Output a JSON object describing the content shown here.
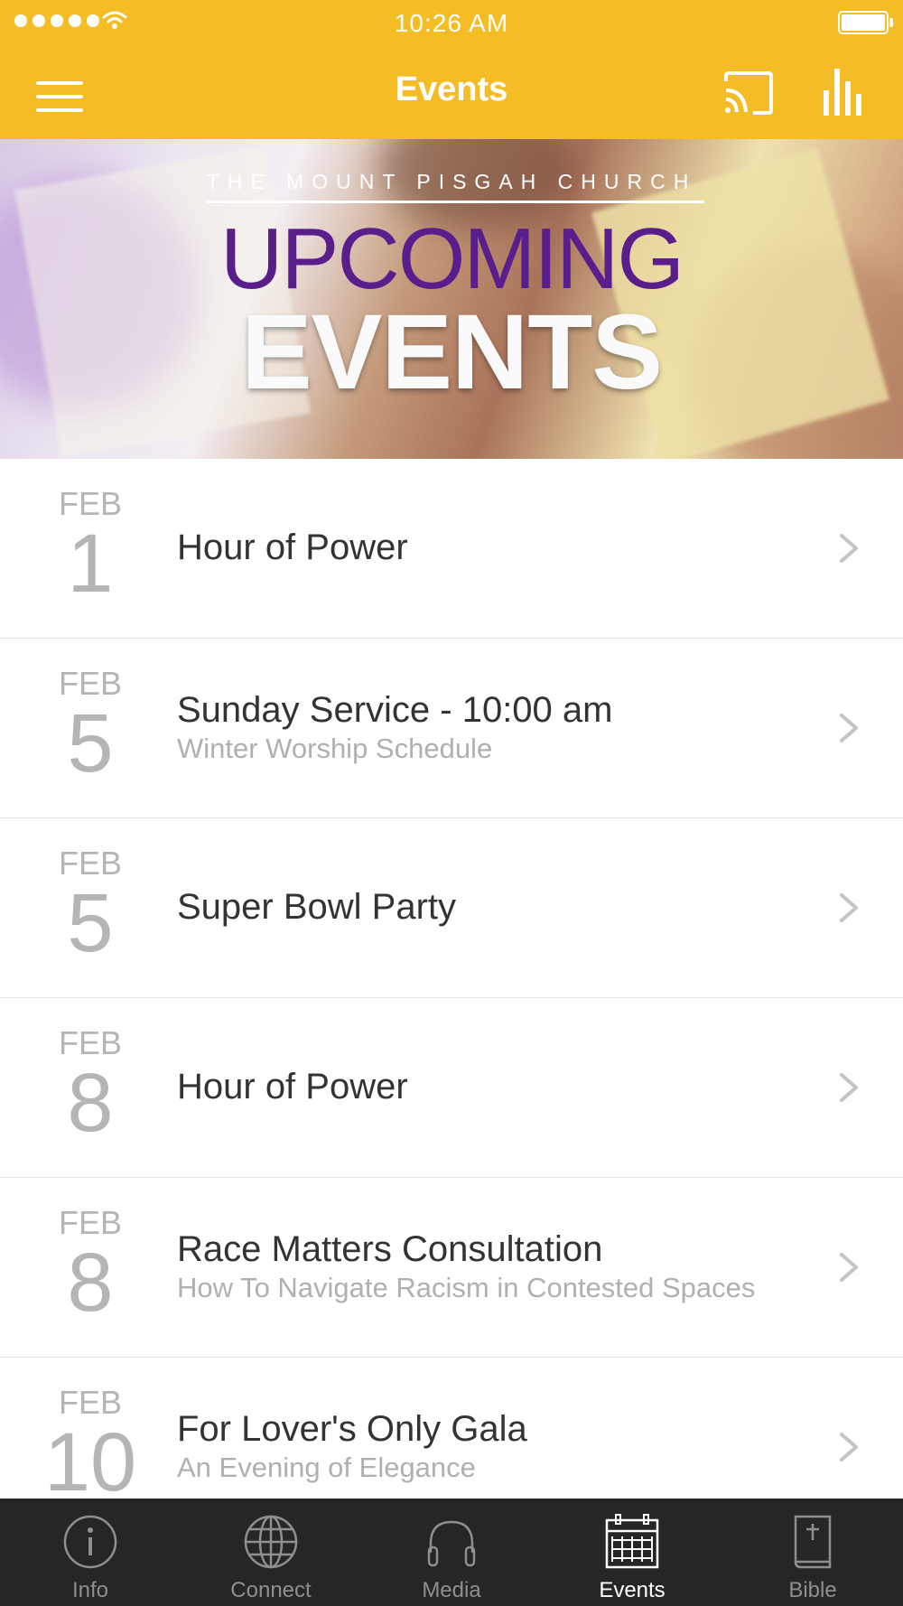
{
  "status_bar": {
    "time": "10:26 AM"
  },
  "nav": {
    "title": "Events"
  },
  "banner": {
    "subtitle": "THE MOUNT PISGAH CHURCH",
    "headline_1": "UPCOMING",
    "headline_2": "EVENTS"
  },
  "events": [
    {
      "month": "FEB",
      "day": "1",
      "title": "Hour of Power",
      "subtitle": ""
    },
    {
      "month": "FEB",
      "day": "5",
      "title": "Sunday Service  - 10:00 am",
      "subtitle": "Winter Worship Schedule"
    },
    {
      "month": "FEB",
      "day": "5",
      "title": "Super Bowl Party",
      "subtitle": ""
    },
    {
      "month": "FEB",
      "day": "8",
      "title": "Hour of Power",
      "subtitle": ""
    },
    {
      "month": "FEB",
      "day": "8",
      "title": "Race Matters Consultation",
      "subtitle": "How To Navigate Racism in Contested Spaces"
    },
    {
      "month": "FEB",
      "day": "10",
      "title": "For Lover's Only Gala",
      "subtitle": "An Evening of Elegance"
    }
  ],
  "tabs": [
    {
      "label": "Info",
      "icon": "info-icon",
      "active": false
    },
    {
      "label": "Connect",
      "icon": "globe-icon",
      "active": false
    },
    {
      "label": "Media",
      "icon": "headphones-icon",
      "active": false
    },
    {
      "label": "Events",
      "icon": "calendar-icon",
      "active": true
    },
    {
      "label": "Bible",
      "icon": "bible-icon",
      "active": false
    }
  ],
  "colors": {
    "accent": "#f4bd25",
    "tabbar_bg": "#262626",
    "banner_purple": "#5a1d8c"
  }
}
